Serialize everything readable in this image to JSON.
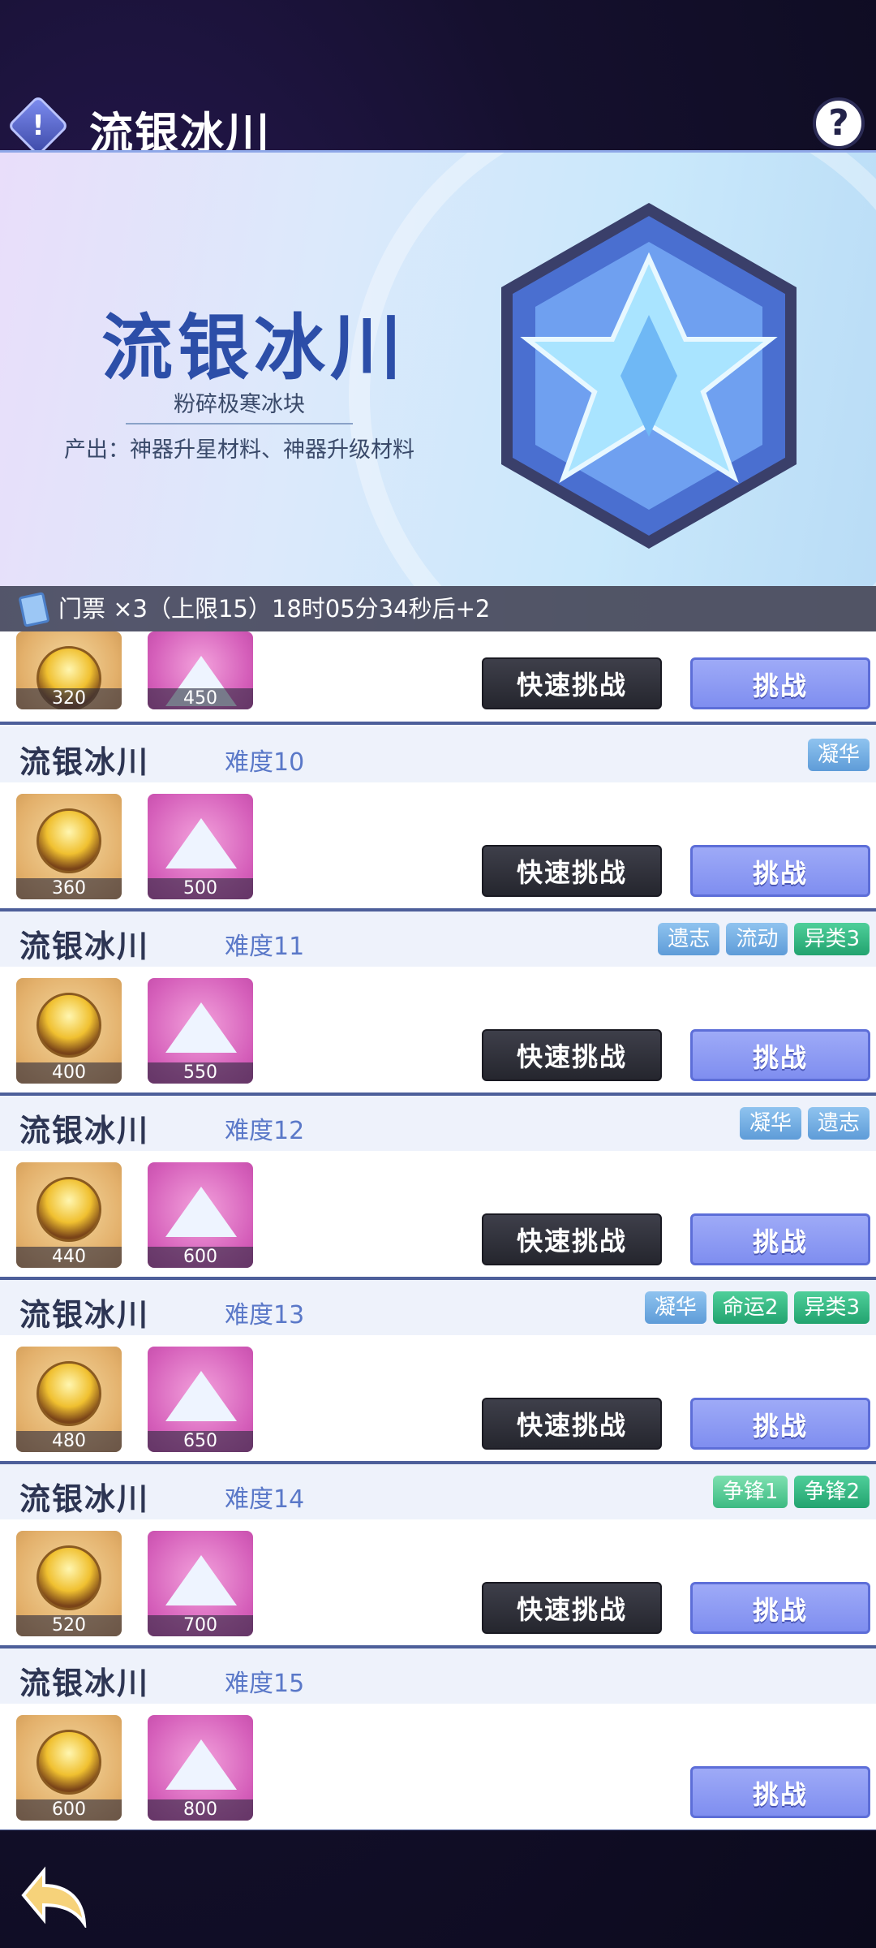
{
  "header": {
    "title": "流银冰川",
    "info_icon": "info-icon",
    "help_icon": "question-icon"
  },
  "banner": {
    "title": "流银冰川",
    "subtitle": "粉碎极寒冰块",
    "description": "产出：神器升星材料、神器升级材料"
  },
  "ticket": {
    "text": "门票 ×3（上限15）18时05分34秒后+2"
  },
  "buttons": {
    "quick": "快速挑战",
    "challenge": "挑战"
  },
  "partial_row": {
    "rewards": [
      "320",
      "450"
    ]
  },
  "rows": [
    {
      "name": "流银冰川",
      "difficulty": "难度10",
      "tags": [
        {
          "label": "凝华",
          "color": "blue"
        }
      ],
      "rewards": [
        "360",
        "500"
      ],
      "quick": true
    },
    {
      "name": "流银冰川",
      "difficulty": "难度11",
      "tags": [
        {
          "label": "遗志",
          "color": "blue"
        },
        {
          "label": "流动",
          "color": "blue"
        },
        {
          "label": "异类3",
          "color": "green"
        }
      ],
      "rewards": [
        "400",
        "550"
      ],
      "quick": true
    },
    {
      "name": "流银冰川",
      "difficulty": "难度12",
      "tags": [
        {
          "label": "凝华",
          "color": "blue"
        },
        {
          "label": "遗志",
          "color": "blue"
        }
      ],
      "rewards": [
        "440",
        "600"
      ],
      "quick": true
    },
    {
      "name": "流银冰川",
      "difficulty": "难度13",
      "tags": [
        {
          "label": "凝华",
          "color": "blue"
        },
        {
          "label": "命运2",
          "color": "green"
        },
        {
          "label": "异类3",
          "color": "green"
        }
      ],
      "rewards": [
        "480",
        "650"
      ],
      "quick": true
    },
    {
      "name": "流银冰川",
      "difficulty": "难度14",
      "tags": [
        {
          "label": "争锋1",
          "color": "mint"
        },
        {
          "label": "争锋2",
          "color": "green"
        }
      ],
      "rewards": [
        "520",
        "700"
      ],
      "quick": true
    },
    {
      "name": "流银冰川",
      "difficulty": "难度15",
      "tags": [],
      "rewards": [
        "600",
        "800"
      ],
      "quick": false
    }
  ],
  "footer": {
    "back_icon": "back-arrow-icon"
  }
}
